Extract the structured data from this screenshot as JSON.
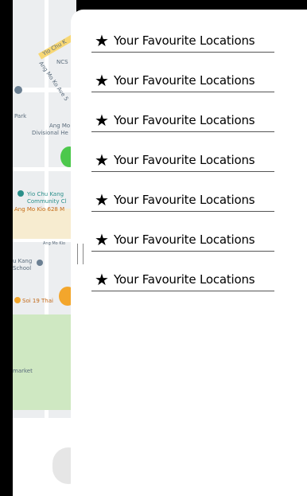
{
  "map": {
    "labels": {
      "yio_chu_road": "Yio Chu K",
      "ncs": "NCS",
      "ang_mo_ko_ave": "Ang Mo Ko Ave 5",
      "park": "Park",
      "ang_mo_division": "Ang Mo",
      "division_he": "Divisional He",
      "yio_chu_kang_community": "Yio Chu Kang",
      "community": "Community Cl",
      "ang_mo_kio_628": "Ang Mo Kio 628 M",
      "ang_mo_kio_st": "Ang Mo Kio",
      "u_kang": "u Kang",
      "school": "School",
      "soi_19": "Soi 19 Thai",
      "market": "market"
    }
  },
  "favourites": {
    "items": [
      {
        "icon": "star-icon",
        "label": "Your Favourite Locations"
      },
      {
        "icon": "star-icon",
        "label": "Your Favourite Locations"
      },
      {
        "icon": "star-icon",
        "label": "Your Favourite Locations"
      },
      {
        "icon": "star-icon",
        "label": "Your Favourite Locations"
      },
      {
        "icon": "star-icon",
        "label": "Your Favourite Locations"
      },
      {
        "icon": "star-icon",
        "label": "Your Favourite Locations"
      },
      {
        "icon": "star-icon",
        "label": "Your Favourite Locations"
      }
    ]
  }
}
